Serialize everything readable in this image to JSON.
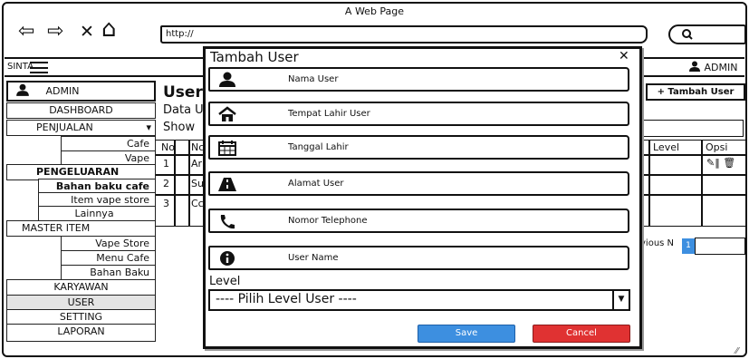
{
  "browser": {
    "title": "A Web Page",
    "url": "http://",
    "search_icon": "search-icon",
    "nav_back": "⇦",
    "nav_forward": "⇨",
    "nav_close": "✕",
    "nav_home": "⌂"
  },
  "app": {
    "brand": "SINTA",
    "user_menu": "ADMIN"
  },
  "sidebar": {
    "profile": "ADMIN",
    "items": [
      {
        "label": "DASHBOARD"
      },
      {
        "label": "PENJUALAN",
        "caret": "▾"
      },
      {
        "label": "Cafe"
      },
      {
        "label": "Vape"
      },
      {
        "label": "PENGELUARAN"
      },
      {
        "label": "Bahan baku cafe"
      },
      {
        "label": "Item vape store"
      },
      {
        "label": "Lainnya"
      },
      {
        "label": "MASTER ITEM"
      },
      {
        "label": "Vape Store"
      },
      {
        "label": "Menu Cafe"
      },
      {
        "label": "Bahan Baku"
      },
      {
        "label": "KARYAWAN"
      },
      {
        "label": "USER"
      },
      {
        "label": "SETTING"
      },
      {
        "label": "LAPORAN"
      }
    ]
  },
  "main": {
    "heading": "User",
    "subheading": "Data U",
    "show_label": "Show",
    "add_button": "+ Tambah User",
    "table": {
      "headers": [
        "No",
        "Nc",
        "Level",
        "Opsi"
      ],
      "rows": [
        {
          "no": "1",
          "name": "Ar"
        },
        {
          "no": "2",
          "name": "Su"
        },
        {
          "no": "3",
          "name": "Cc"
        }
      ],
      "row_actions": "✎‖ 🗑"
    },
    "pagination": {
      "previous": "vious N",
      "current": "1"
    }
  },
  "modal": {
    "title": "Tambah User",
    "close": "✕",
    "fields": [
      {
        "label": "Nama User",
        "icon": "user-icon"
      },
      {
        "label": "Tempat Lahir User",
        "icon": "home-icon"
      },
      {
        "label": "Tanggal Lahir",
        "icon": "calendar-icon"
      },
      {
        "label": "Alamat User",
        "icon": "road-icon"
      },
      {
        "label": "Nomor Telephone",
        "icon": "phone-icon"
      },
      {
        "label": "User Name",
        "icon": "info-icon"
      }
    ],
    "level_label": "Level",
    "level_select": "---- Pilih Level User ----",
    "save": "Save",
    "cancel": "Cancel",
    "colors": {
      "save": "#3d8fe0",
      "cancel": "#e03232"
    }
  }
}
